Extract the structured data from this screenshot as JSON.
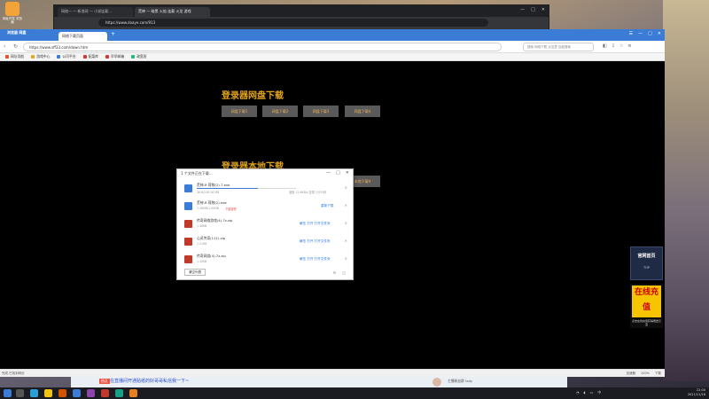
{
  "desktop": {
    "icons": [
      {
        "label": "网址开发 浏览器"
      },
      {
        "label": "新建游戏"
      }
    ]
  },
  "back_window": {
    "tabs": [
      "网络一 — 新浪网 — 小说连载…",
      "荒神 — 暗黑 火焰 连载 火龙 游戏"
    ],
    "address": "https://www.doaye.com/913"
  },
  "browser": {
    "logo_text": "浏览器 网盘",
    "tab_title": "网络下载页面",
    "new_tab": "+",
    "address": "https://www.sff33.com/down.htm",
    "search_placeholder": "搜索 网络下载 点这里 百度搜索",
    "bookmarks": [
      {
        "label": "网址导航",
        "color": "#e5532d"
      },
      {
        "label": "游戏中心",
        "color": "#f1a11e"
      },
      {
        "label": "公司平台",
        "color": "#3a7cd6"
      },
      {
        "label": "配菜库",
        "color": "#d33"
      },
      {
        "label": "早早邮箱",
        "color": "#d33"
      },
      {
        "label": "政宽班",
        "color": "#2b7"
      }
    ]
  },
  "page": {
    "netdisk_title": "登录器网盘下载",
    "netdisk_buttons": [
      "网盘下载1",
      "网盘下载2",
      "网盘下载3",
      "网盘下载4"
    ],
    "local_title": "登录器本地下载",
    "local_buttons": [
      "本地下载1",
      "本地下载2",
      "本地下载3",
      "本地下载4"
    ]
  },
  "download_dialog": {
    "title": "1 个文件正在下载…",
    "items": [
      {
        "name": "荒神-R 荷物(2).7.exe",
        "size": "36.8/246.56 MB",
        "status": "",
        "speed": "速度 12.6KB/s 还需 1分25秒",
        "progress": 0.62,
        "action": "",
        "color": "#3a7cd6"
      },
      {
        "name": "荒神-R 荷物(2).exe",
        "size": "1.38MB/1.00MB",
        "status": "下载暂停",
        "speed": "",
        "progress": 0,
        "action": "重新下载",
        "color": "#3a7cd6"
      },
      {
        "name": "传奇网络游戏(4).7z.zip",
        "size": "1.46KB",
        "status": "",
        "speed": "",
        "progress": 0,
        "action": "解压   打开   打开文件夹",
        "color": "#c0392b"
      },
      {
        "name": "心灵传奇(111).zip",
        "size": "1.51KB",
        "status": "",
        "speed": "",
        "progress": 0,
        "action": "解压   打开   打开文件夹",
        "color": "#c0392b"
      },
      {
        "name": "传奇网游(4).7z.zip",
        "size": "1.40KB",
        "status": "",
        "speed": "",
        "progress": 0,
        "action": "解压   打开   打开文件夹",
        "color": "#c0392b"
      }
    ],
    "clear_label": "清空列表"
  },
  "floating": {
    "official_title": "官网首页",
    "official_sub": "TOP",
    "charge_title": "在线充值",
    "charge_sub": "点击在线充值获得赠送元宝"
  },
  "statusbar": {
    "left": "完成 已找到网页",
    "right": [
      "加速器",
      "100%",
      "下载"
    ]
  },
  "ad": {
    "badge": "热点",
    "text": "在直播间开通贴纸的好哥哥私信我一下~",
    "user": "主播粉丝群 lady"
  },
  "taskbar": {
    "time": "22:00",
    "date": "2021/11/16"
  }
}
